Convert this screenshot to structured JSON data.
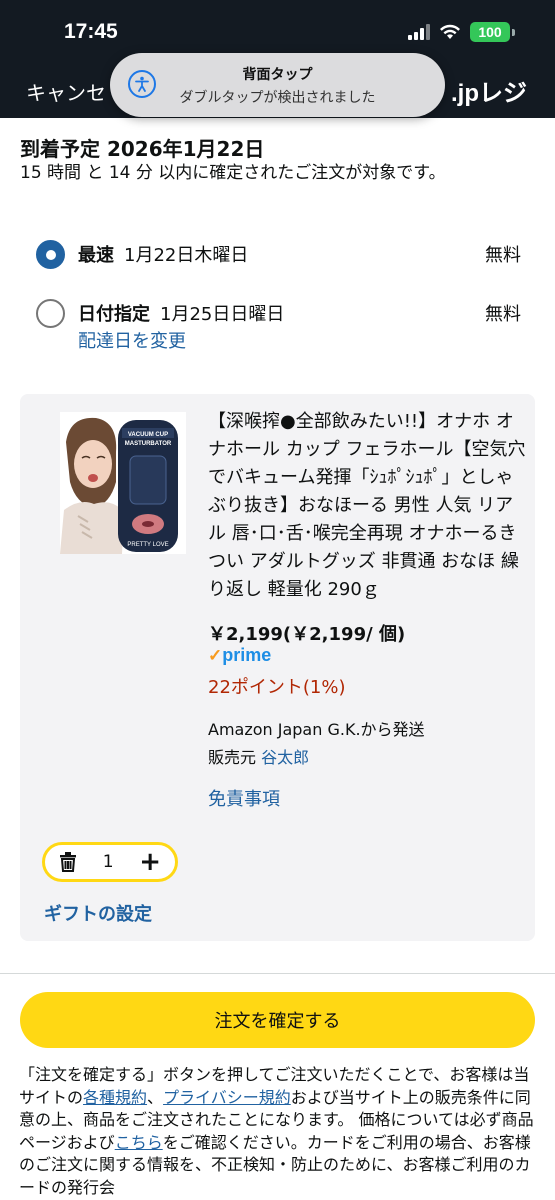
{
  "status_bar": {
    "time": "17:45",
    "battery": "100"
  },
  "nav": {
    "cancel_label": "キャンセ",
    "title_suffix": ".jpレジ"
  },
  "toast": {
    "title": "背面タップ",
    "subtitle": "ダブルタップが検出されました"
  },
  "delivery": {
    "arrival": "到着予定 2026年1月22日",
    "note": "15 時間 と 14 分 以内に確定されたご注文が対象です。",
    "options": [
      {
        "name": "最速",
        "date": "1月22日木曜日",
        "fee": "無料",
        "selected": true
      },
      {
        "name": "日付指定",
        "date": "1月25日日曜日",
        "fee": "無料",
        "selected": false,
        "change_link": "配達日を変更"
      }
    ]
  },
  "product": {
    "title": "【深喉搾●全部飲みたい!!】オナホ オナホール カップ フェラホール【空気穴でバキューム発揮「ｼｭﾎﾟｼｭﾎﾟ」としゃぶり抜き】おなほーる 男性 人気 リアル 唇･口･舌･喉完全再現 オナホーるきつい アダルトグッズ 非貫通 おなほ 繰り返し 軽量化 290ｇ",
    "price": "￥2,199(￥2,199/ 個)",
    "prime": "prime",
    "points": "22ポイント(1%)",
    "ships_from": "Amazon Japan G.K.から発送",
    "seller_label": "販売元",
    "seller_name": "谷太郎",
    "disclaimer": "免責事項",
    "quantity": "1",
    "gift": "ギフトの設定",
    "image_text": [
      "VACUUM CUP",
      "MASTURBATOR",
      "PRETTY LOVE"
    ]
  },
  "checkout": {
    "confirm_label": "注文を確定する",
    "legal_1": "「注文を確定する」ボタンを押してご注文いただくことで、お客様は当サイトの",
    "legal_link_1": "各種規約",
    "legal_2": "、",
    "legal_link_2": "プライバシー規約",
    "legal_3": "および当サイト上の販売条件に同意の上、商品をご注文されたことになります。 価格については必ず商品ページおよび",
    "legal_link_3": "こちら",
    "legal_4": "をご確認ください。カードをご利用の場合、お客様のご注文に関する情報を、不正検知・防止のために、お客様ご利用のカードの発行会"
  },
  "colors": {
    "header_bg": "#131a22",
    "confirm_bg": "#ffd814",
    "link": "#2162a1",
    "points": "#b12704",
    "selected_radio": "#2162a1"
  }
}
